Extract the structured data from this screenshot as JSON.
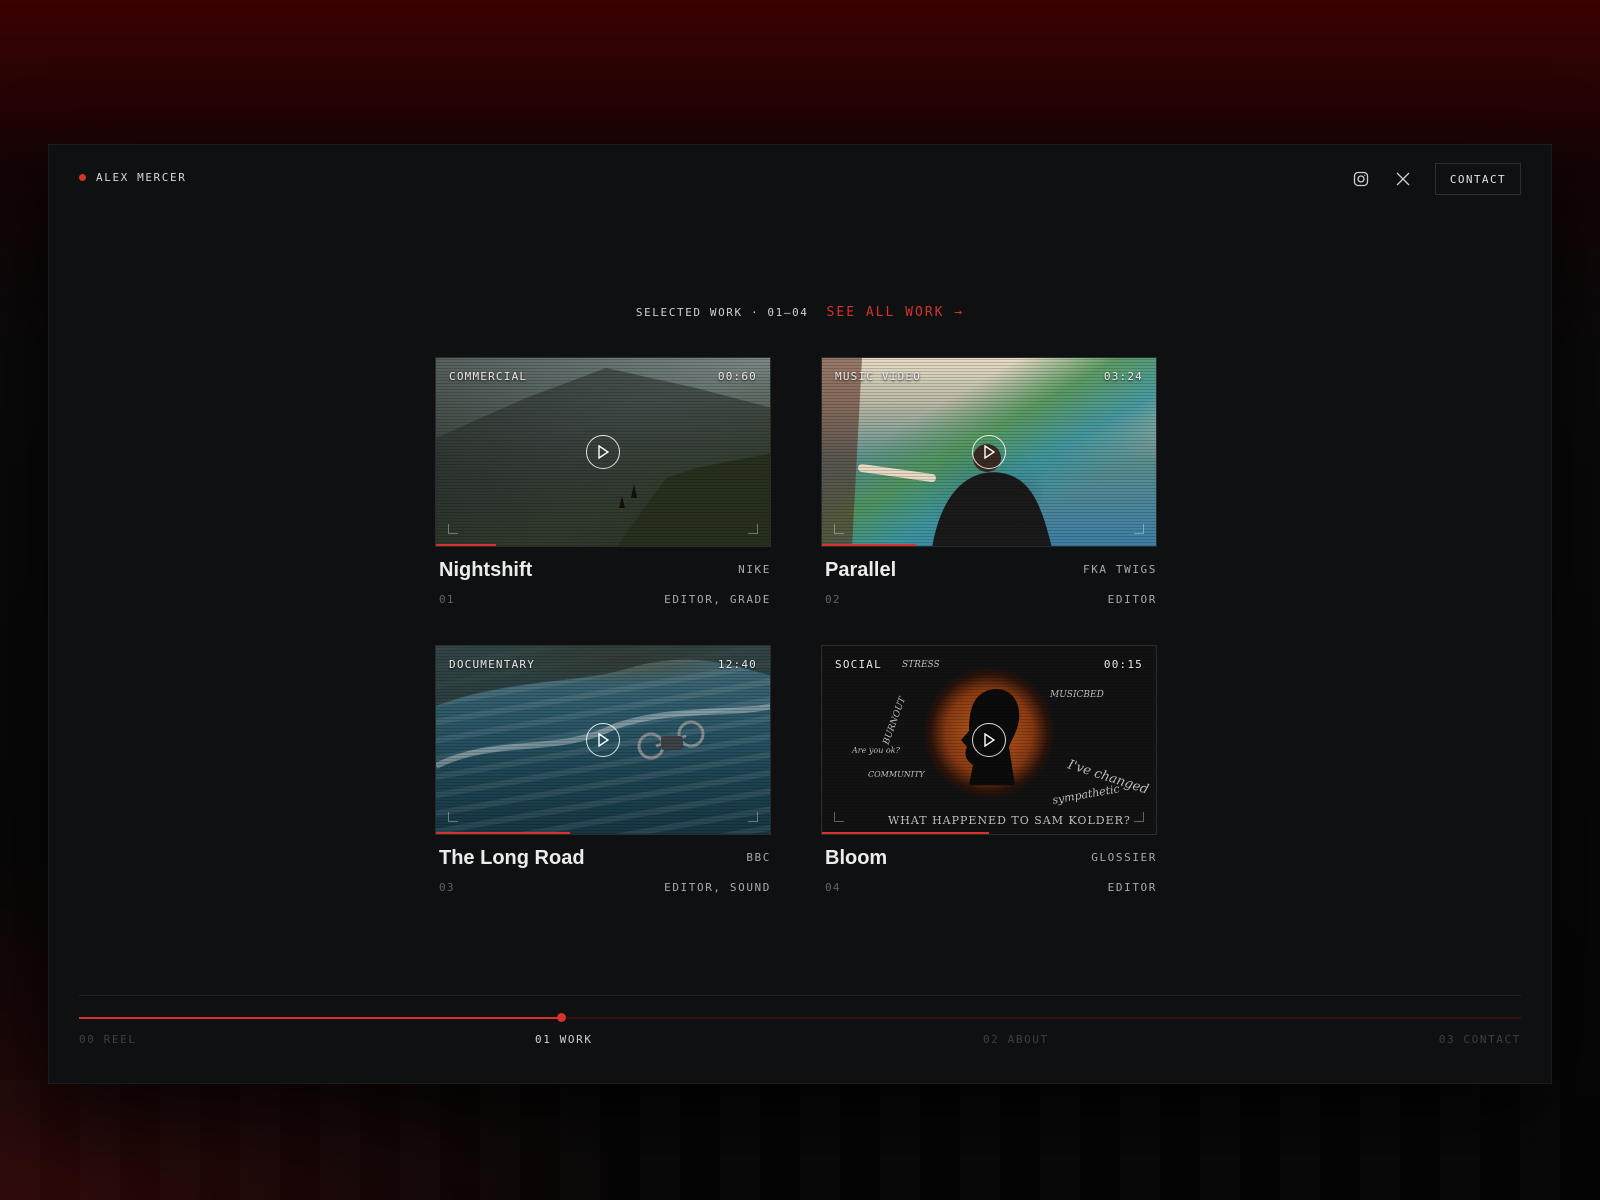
{
  "brand": {
    "name": "ALEX MERCER",
    "accent": "#d6322b"
  },
  "header": {
    "social": [
      "instagram-icon",
      "x-icon"
    ],
    "contact_label": "CONTACT"
  },
  "section": {
    "label": "SELECTED WORK · 01—04",
    "see_all": "SEE ALL WORK →"
  },
  "projects": [
    {
      "tag": "COMMERCIAL",
      "duration": "00:60",
      "title": "Nightshift",
      "client": "NIKE",
      "num": "01",
      "role": "EDITOR, GRADE",
      "progress": 0.18
    },
    {
      "tag": "MUSIC VIDEO",
      "duration": "03:24",
      "title": "Parallel",
      "client": "FKA TWIGS",
      "num": "02",
      "role": "EDITOR",
      "progress": 0.28
    },
    {
      "tag": "DOCUMENTARY",
      "duration": "12:40",
      "title": "The Long Road",
      "client": "BBC",
      "num": "03",
      "role": "EDITOR, SOUND",
      "progress": 0.4
    },
    {
      "tag": "SOCIAL",
      "duration": "00:15",
      "title": "Bloom",
      "client": "GLOSSIER",
      "num": "04",
      "role": "EDITOR",
      "progress": 0.5
    }
  ],
  "bloom_text": {
    "line1": "WHAT HAPPENED TO SAM KOLDER?",
    "w1": "STRESS",
    "w2": "BURNOUT",
    "w3": "MUSICBED",
    "w4": "I've changed",
    "w5": "sympathetic",
    "w6": "COMMUNITY",
    "w7": "Are you ok?"
  },
  "timeline": {
    "steps": [
      "00 REEL",
      "01 WORK",
      "02 ABOUT",
      "03 CONTACT"
    ],
    "active_index": 1,
    "progress": 0.334
  }
}
